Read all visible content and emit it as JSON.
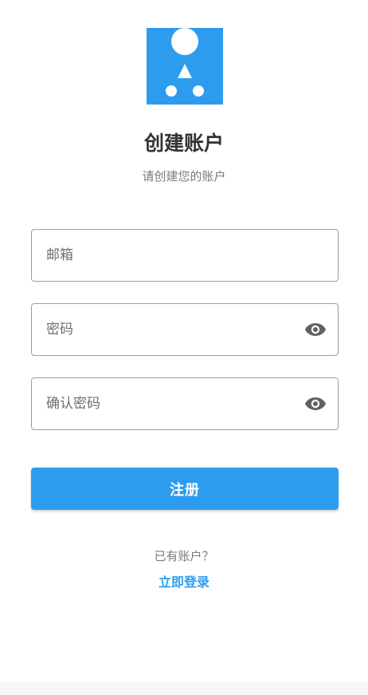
{
  "app": {
    "title": "创建账户",
    "subtitle": "请创建您的账户",
    "brand_color": "#2d9cee",
    "logo_icon": "app-logo-icon"
  },
  "form": {
    "email": {
      "placeholder": "邮箱",
      "value": ""
    },
    "password": {
      "placeholder": "密码",
      "value": "",
      "toggle_icon": "eye-icon"
    },
    "confirm_password": {
      "placeholder": "确认密码",
      "value": "",
      "toggle_icon": "eye-icon"
    },
    "submit_label": "注册"
  },
  "footer": {
    "prompt": "已有账户？",
    "login_link": "立即登录"
  }
}
